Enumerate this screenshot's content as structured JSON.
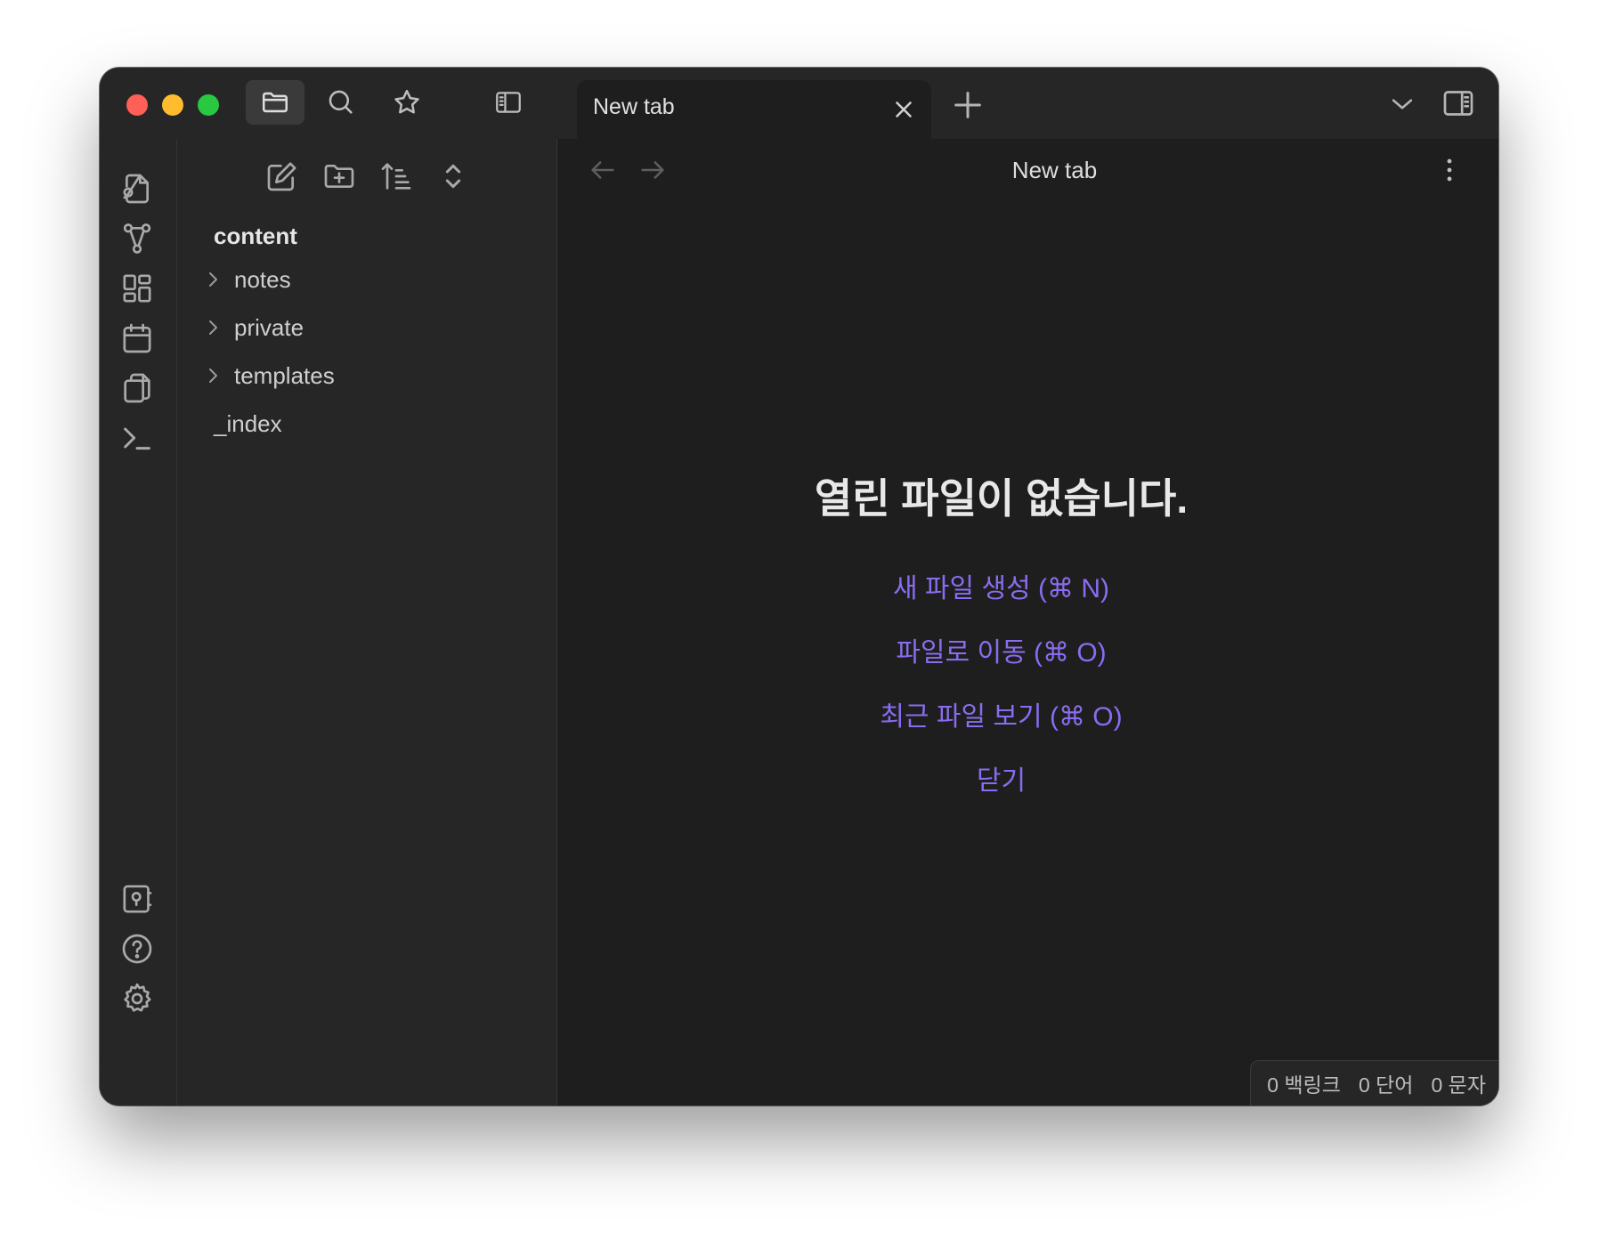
{
  "tab": {
    "label": "New tab"
  },
  "view": {
    "title": "New tab"
  },
  "sidebar": {
    "vault_name": "content",
    "folders": [
      {
        "label": "notes"
      },
      {
        "label": "private"
      },
      {
        "label": "templates"
      }
    ],
    "files": [
      {
        "label": "_index"
      }
    ]
  },
  "empty_state": {
    "title": "열린 파일이 없습니다.",
    "actions": [
      {
        "label": "새 파일 생성 (⌘ N)"
      },
      {
        "label": "파일로 이동 (⌘ O)"
      },
      {
        "label": "최근 파일 보기 (⌘ O)"
      },
      {
        "label": "닫기"
      }
    ]
  },
  "status": {
    "backlinks": "0 백링크",
    "words": "0 단어",
    "chars": "0 문자"
  },
  "colors": {
    "accent": "#8a6cf0",
    "background": "#1e1e1e",
    "panel": "#262626"
  },
  "icons": {
    "titlebar": [
      "folder-icon",
      "search-icon",
      "star-icon",
      "sidebar-toggle-icon"
    ],
    "ribbon": [
      "quick-switcher-icon",
      "graph-icon",
      "canvas-icon",
      "calendar-icon",
      "templates-icon",
      "terminal-icon",
      "vault-icon",
      "help-icon",
      "settings-icon"
    ]
  }
}
